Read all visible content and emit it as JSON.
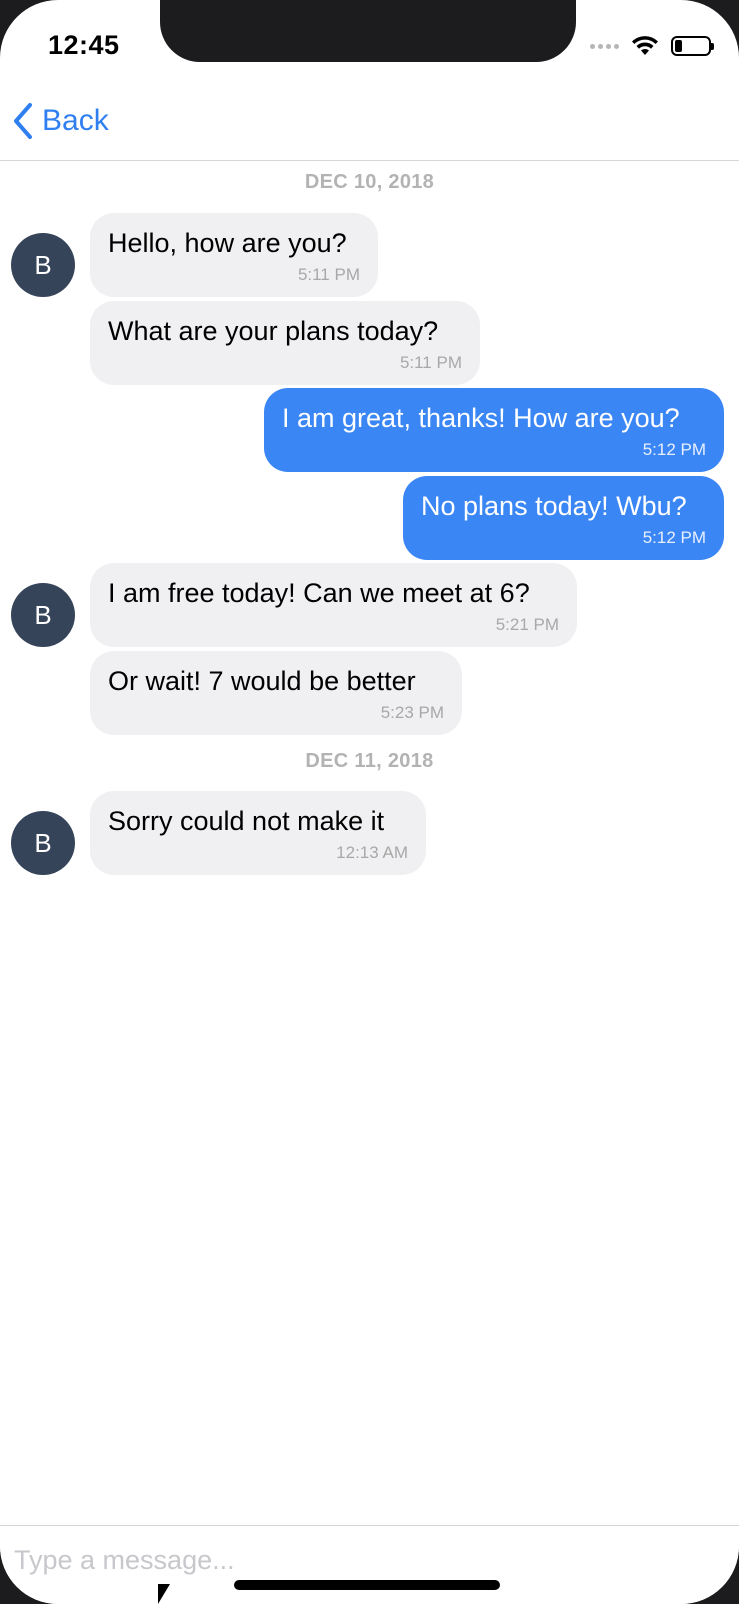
{
  "status_bar": {
    "time": "12:45",
    "battery_level": 0.2
  },
  "nav": {
    "back_label": "Back"
  },
  "conversation": [
    {
      "type": "date",
      "label": "DEC 10, 2018"
    },
    {
      "type": "message",
      "direction": "in",
      "avatar": "B",
      "text": "Hello, how are you?",
      "time": "5:11 PM"
    },
    {
      "type": "message",
      "direction": "in",
      "text": "What are your plans today?",
      "time": "5:11 PM"
    },
    {
      "type": "message",
      "direction": "out",
      "text": "I am great, thanks! How are you?",
      "time": "5:12 PM"
    },
    {
      "type": "message",
      "direction": "out",
      "text": "No plans today! Wbu?",
      "time": "5:12 PM"
    },
    {
      "type": "message",
      "direction": "in",
      "avatar": "B",
      "text": "I am free today! Can we meet at 6?",
      "time": "5:21 PM"
    },
    {
      "type": "message",
      "direction": "in",
      "text": "Or wait! 7 would be better",
      "time": "5:23 PM"
    },
    {
      "type": "date",
      "label": "DEC 11, 2018"
    },
    {
      "type": "message",
      "direction": "in",
      "avatar": "B",
      "text": "Sorry could not make it",
      "time": "12:13 AM"
    }
  ],
  "composer": {
    "placeholder": "Type a message...",
    "value": ""
  },
  "colors": {
    "accent": "#2f7ff0",
    "outgoing_bubble": "#3a86f4",
    "incoming_bubble": "#f0f0f2",
    "avatar": "#36445a"
  },
  "icons": {
    "back": "chevron-left-icon",
    "wifi": "wifi-icon",
    "battery": "battery-icon",
    "signal": "signal-dots-icon"
  }
}
